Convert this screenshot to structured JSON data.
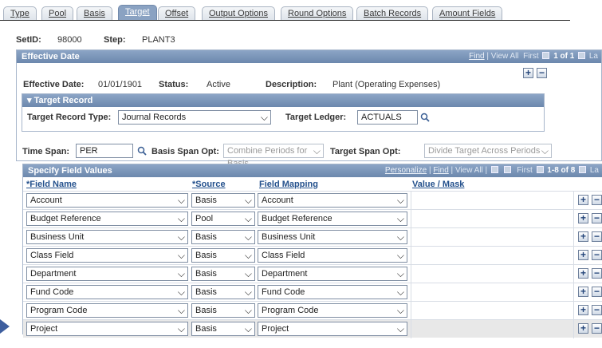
{
  "tabs": [
    {
      "label": "Type",
      "active": false
    },
    {
      "label": "Pool",
      "active": false
    },
    {
      "label": "Basis",
      "active": false
    },
    {
      "label": "Target",
      "active": true
    },
    {
      "label": "Offset",
      "active": false
    },
    {
      "label": "Output Options",
      "active": false
    },
    {
      "label": "Round Options",
      "active": false
    },
    {
      "label": "Batch Records",
      "active": false
    },
    {
      "label": "Amount Fields",
      "active": false
    }
  ],
  "header": {
    "setid_label": "SetID:",
    "setid_value": "98000",
    "step_label": "Step:",
    "step_value": "PLANT3"
  },
  "effective": {
    "title": "Effective Date",
    "nav_find": "Find",
    "nav_view_all": "View All",
    "nav_first": "First",
    "nav_count": "1 of 1",
    "nav_last": "La",
    "date_label": "Effective Date:",
    "date_value": "01/01/1901",
    "status_label": "Status:",
    "status_value": "Active",
    "desc_label": "Description:",
    "desc_value": "Plant (Operating Expenses)"
  },
  "target_record": {
    "title": "Target Record",
    "type_label": "Target Record Type:",
    "type_value": "Journal Records",
    "ledger_label": "Target Ledger:",
    "ledger_value": "ACTUALS"
  },
  "span": {
    "time_label": "Time Span:",
    "time_value": "PER",
    "basis_label": "Basis Span Opt:",
    "basis_value": "Combine Periods for Basis",
    "target_label": "Target Span Opt:",
    "target_value": "Divide Target Across Periods"
  },
  "field_values": {
    "title": "Specify Field Values",
    "nav_personalize": "Personalize",
    "nav_find": "Find",
    "nav_view_all": "View All",
    "nav_first": "First",
    "nav_count": "1-8 of 8",
    "nav_last": "La",
    "col_field_name": "*Field Name",
    "col_source": "*Source",
    "col_field_mapping": "Field Mapping",
    "col_value_mask": "Value / Mask",
    "rows": [
      {
        "field": "Account",
        "source": "Basis",
        "mapping": "Account"
      },
      {
        "field": "Budget Reference",
        "source": "Pool",
        "mapping": "Budget Reference"
      },
      {
        "field": "Business Unit",
        "source": "Basis",
        "mapping": "Business Unit"
      },
      {
        "field": "Class Field",
        "source": "Basis",
        "mapping": "Class Field"
      },
      {
        "field": "Department",
        "source": "Basis",
        "mapping": "Department"
      },
      {
        "field": "Fund Code",
        "source": "Basis",
        "mapping": "Fund Code"
      },
      {
        "field": "Program Code",
        "source": "Basis",
        "mapping": "Program Code"
      },
      {
        "field": "Project",
        "source": "Basis",
        "mapping": "Project"
      }
    ]
  },
  "icons": {
    "add": "+",
    "remove": "−",
    "chevron": "⌵",
    "collapse": "▾"
  },
  "colors": {
    "header_blue": "#6c88ad",
    "link_blue": "#23508c",
    "active_tab": "#8aa2c2",
    "pointer_arrow": "#3d5e9e"
  }
}
